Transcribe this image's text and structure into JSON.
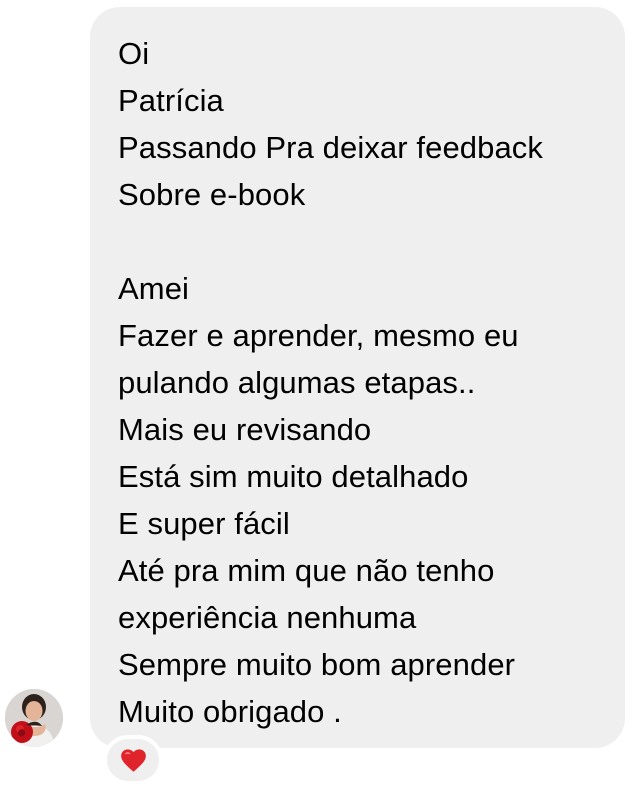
{
  "message": {
    "lines": [
      "Oi",
      "Patrícia",
      "Passando Pra deixar feedback",
      "Sobre e-book",
      "",
      "Amei",
      "Fazer e aprender, mesmo eu",
      "pulando algumas etapas..",
      "Mais eu revisando",
      "Está sim muito detalhado",
      "E super fácil",
      "Até pra mim que não tenho",
      "experiência nenhuma",
      "Sempre muito bom aprender",
      "Muito obrigado ."
    ],
    "reaction_icon": "red-heart-icon",
    "sender_avatar_icon": "profile-photo"
  },
  "colors": {
    "bubble_background": "#efefef",
    "text": "#000000",
    "heart": "#e0242c",
    "page_background": "#ffffff"
  }
}
